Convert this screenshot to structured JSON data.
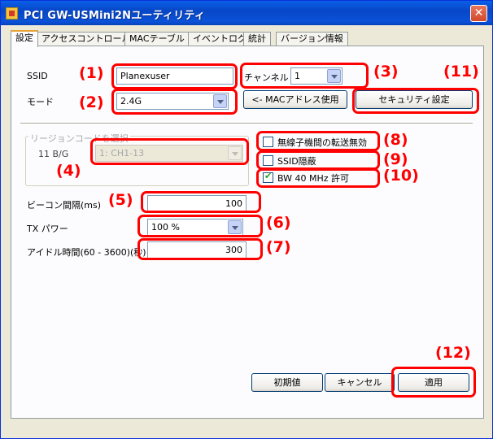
{
  "window": {
    "title": "PCI GW-USMini2Nユーティリティ",
    "close_glyph": "✕"
  },
  "tabs": [
    {
      "label": "設定",
      "active": true
    },
    {
      "label": "アクセスコントロール",
      "active": false
    },
    {
      "label": "MACテーブル",
      "active": false
    },
    {
      "label": "イベントログ",
      "active": false
    },
    {
      "label": "統計",
      "active": false
    },
    {
      "label": "バージョン情報",
      "active": false
    }
  ],
  "form": {
    "ssid": {
      "label": "SSID",
      "value": "Planexuser"
    },
    "channel": {
      "label": "チャンネル",
      "value": "1"
    },
    "mode": {
      "label": "モード",
      "value": "2.4G"
    },
    "mac_button": "<- MACアドレス使用",
    "security_button": "セキュリティ設定",
    "region": {
      "legend": "リージョンコードを選択",
      "label": "11 B/G",
      "value": "1: CH1-13"
    },
    "checks": {
      "no_forward": {
        "label": "無線子機間の転送無効",
        "checked": false
      },
      "hide_ssid": {
        "label": "SSID隠蔽",
        "checked": false
      },
      "bw40": {
        "label": "BW 40 MHz 許可",
        "checked": true
      }
    },
    "beacon": {
      "label": "ビーコン間隔(ms)",
      "value": "100"
    },
    "tx_power": {
      "label": "TX パワー",
      "value": "100 %"
    },
    "idle": {
      "label": "アイドル時間(60 - 3600)(秒)",
      "value": "300"
    }
  },
  "buttons": {
    "defaults": "初期値",
    "cancel": "キャンセル",
    "apply": "適用"
  },
  "annotations": [
    "(1)",
    "(2)",
    "(3)",
    "(4)",
    "(5)",
    "(6)",
    "(7)",
    "(8)",
    "(9)",
    "(10)",
    "(11)",
    "(12)"
  ],
  "colors": {
    "annotation": "#ff0000",
    "titlebar": "#0a52d8",
    "window_bg": "#ece9d8"
  }
}
